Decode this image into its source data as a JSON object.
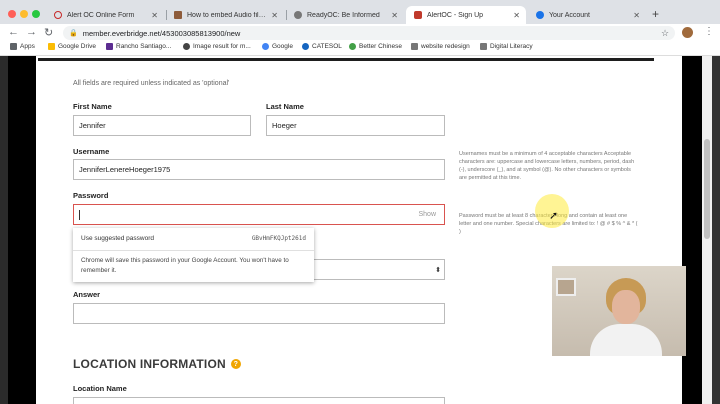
{
  "browser": {
    "tabs": [
      {
        "title": "Alert OC Online Form",
        "active": false,
        "favicon_color": "#c62828"
      },
      {
        "title": "How to embed Audio files in C...",
        "active": false,
        "favicon_color": "#8d5b3a"
      },
      {
        "title": "ReadyOC: Be Informed",
        "active": false,
        "favicon_color": "#555555"
      },
      {
        "title": "AlertOC - Sign Up",
        "active": true,
        "favicon_color": "#c0392b"
      },
      {
        "title": "Your Account",
        "active": false,
        "favicon_color": "#1a73e8"
      }
    ],
    "new_tab": "+",
    "url": "member.everbridge.net/453003085813900/new",
    "bookmarks": [
      "Apps",
      "Google Drive",
      "Rancho Santiago...",
      "Image result for m...",
      "Google",
      "CATESOL",
      "Better Chinese",
      "website redesign",
      "Digital Literacy"
    ]
  },
  "form": {
    "required_note": "All fields are required unless indicated as 'optional'",
    "first_name": {
      "label": "First Name",
      "value": "Jennifer"
    },
    "last_name": {
      "label": "Last Name",
      "value": "Hoeger"
    },
    "username": {
      "label": "Username",
      "value": "JenniferLenereHoeger1975"
    },
    "username_hint": "Usernames must be a minimum of 4 acceptable characters Acceptable characters are: uppercase and lowercase letters, numbers, period, dash (-), underscore (_), and at symbol (@). No other characters or symbols are permitted at this time.",
    "password": {
      "label": "Password",
      "value": "",
      "show_label": "Show"
    },
    "password_hint": "Password must be at least 8 characters long and contain at least one letter and one number. Special characters are limited to: ! @ # $ % ^ & * ( )",
    "suggestion": {
      "title": "Use suggested password",
      "password": "GBvHmFKQJpt261d",
      "description": "Chrome will save this password in your Google Account. You won't have to remember it."
    },
    "answer": {
      "label": "Answer",
      "value": ""
    },
    "location_section": "LOCATION INFORMATION",
    "location_name_label": "Location Name"
  }
}
